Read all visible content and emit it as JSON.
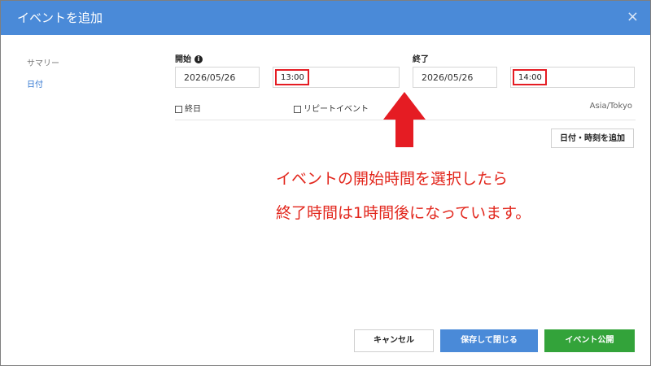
{
  "dialog": {
    "title": "イベントを追加",
    "close_icon": "×"
  },
  "sidebar": {
    "items": [
      {
        "label": "サマリー",
        "active": false
      },
      {
        "label": "日付",
        "active": true
      }
    ]
  },
  "start": {
    "label": "開始",
    "date": "2026/05/26",
    "time": "13:00"
  },
  "end": {
    "label": "終了",
    "date": "2026/05/26",
    "time": "14:00"
  },
  "options": {
    "all_day": "終日",
    "repeat": "リピートイベント",
    "timezone": "Asia/Tokyo"
  },
  "add_datetime_label": "日付・時刻を追加",
  "annotation": {
    "line1": "イベントの開始時間を選択したら",
    "line2": "終了時間は1時間後になっています。",
    "color": "#e2261c"
  },
  "footer": {
    "cancel": "キャンセル",
    "save_close": "保存して閉じる",
    "publish": "イベント公開"
  }
}
